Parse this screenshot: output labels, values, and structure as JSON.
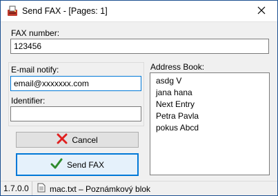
{
  "window": {
    "title": "Send FAX - [Pages: 1]",
    "title_icon": "fax-icon",
    "close_icon": "close-icon"
  },
  "fax_number": {
    "label": "FAX number:",
    "value": "123456"
  },
  "email_notify": {
    "label": "E-mail notify:",
    "value": "email@xxxxxxx.com"
  },
  "identifier": {
    "label": "Identifier:",
    "value": ""
  },
  "address_book": {
    "label": "Address Book:",
    "entries": [
      "asdg V",
      "jana hana",
      "Next Entry",
      "Petra Pavla",
      "pokus Abcd"
    ]
  },
  "buttons": {
    "cancel": {
      "label": "Cancel",
      "icon": "red-x-icon"
    },
    "send": {
      "label": "Send FAX",
      "icon": "green-check-icon"
    }
  },
  "status": {
    "version": "1.7.0.0",
    "file_icon": "document-icon",
    "file": "mac.txt – Poznámkový blok"
  },
  "colors": {
    "focus_border": "#0078d7",
    "cancel_icon": "#e02020",
    "check_icon": "#2e8b2e",
    "window_border": "#1b4f8f"
  }
}
